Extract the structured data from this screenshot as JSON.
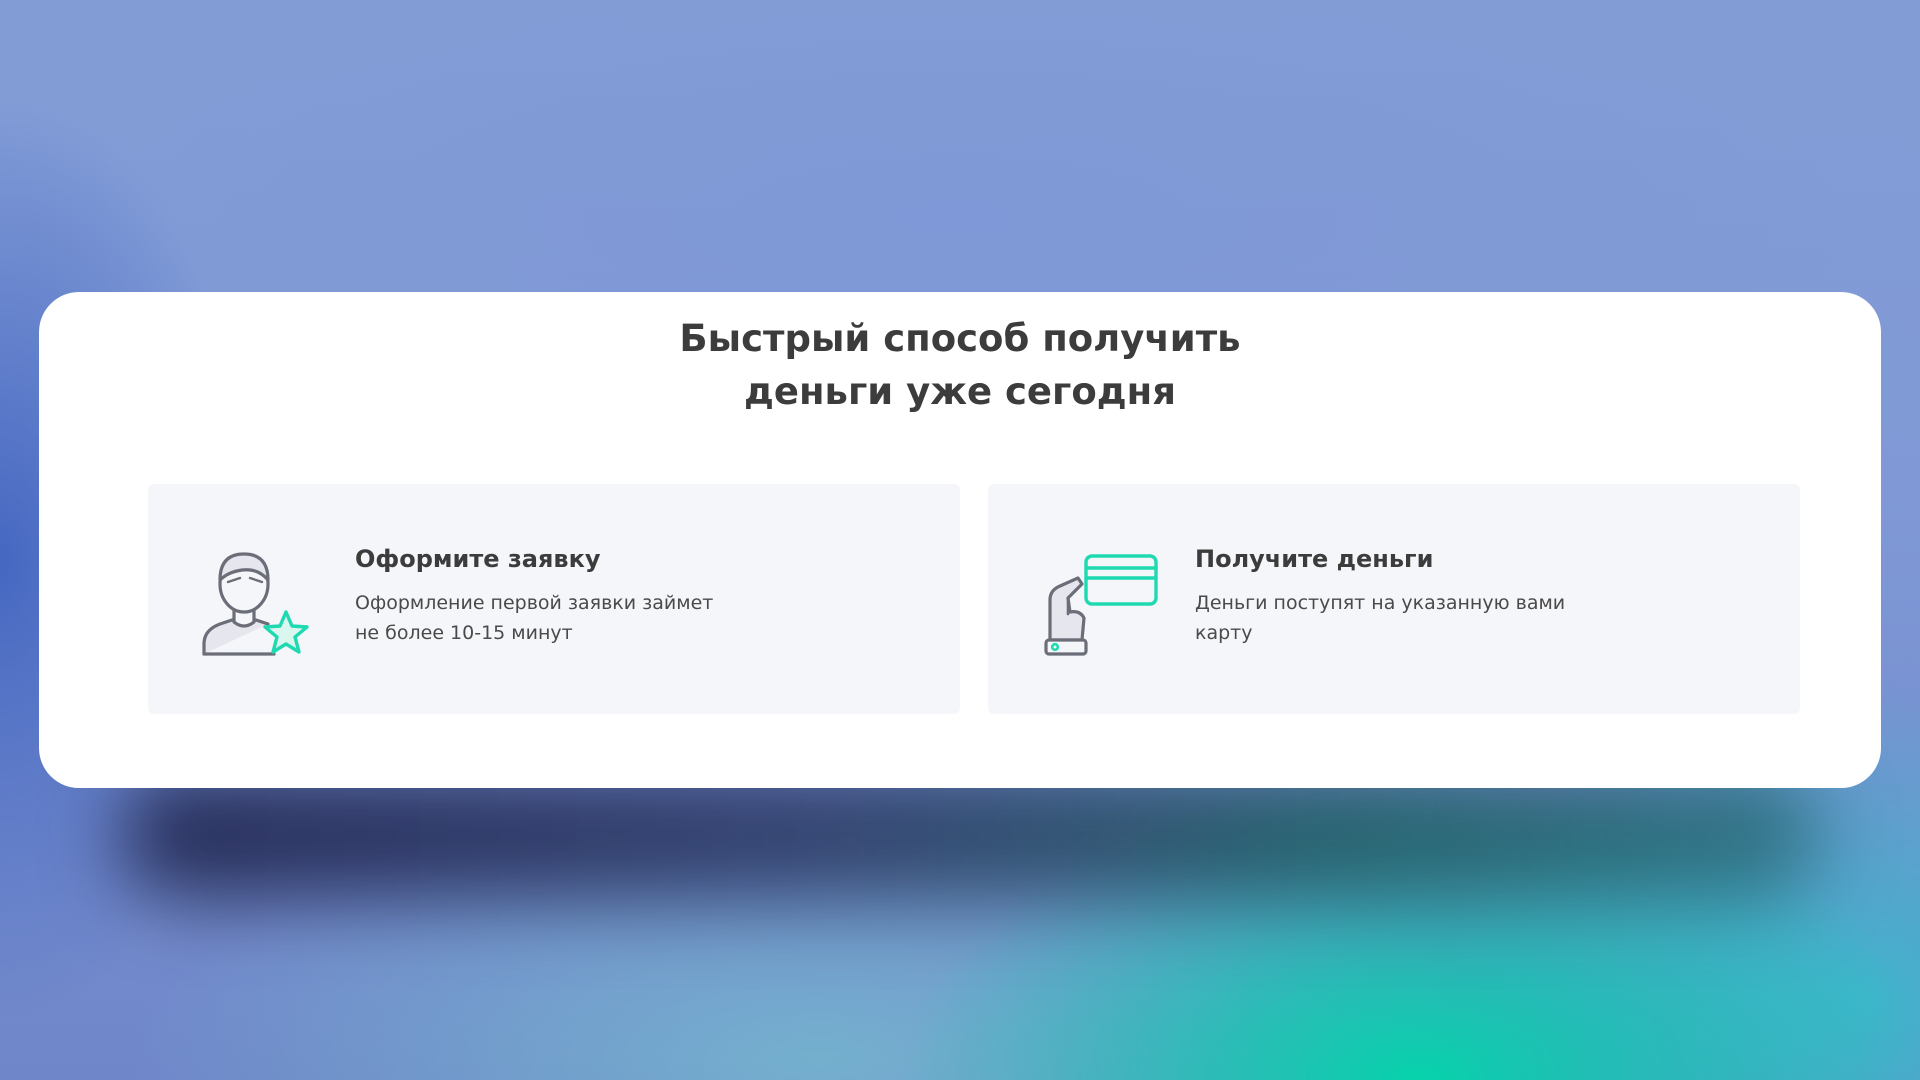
{
  "colors": {
    "accent": "#1fd9b1",
    "icon_stroke": "#6b6e78",
    "card_bg": "#ffffff",
    "feature_bg": "#f5f6f9",
    "text": "#3c3c3c"
  },
  "section": {
    "title_line1": "Быстрый способ получить",
    "title_line2": "деньги уже сегодня"
  },
  "features": [
    {
      "icon": "user-star-icon",
      "title": "Оформите заявку",
      "description": "Оформление первой заявки займет не более 10-15 минут"
    },
    {
      "icon": "hand-card-icon",
      "title": "Получите деньги",
      "description": "Деньги поступят на указанную вами карту"
    }
  ]
}
